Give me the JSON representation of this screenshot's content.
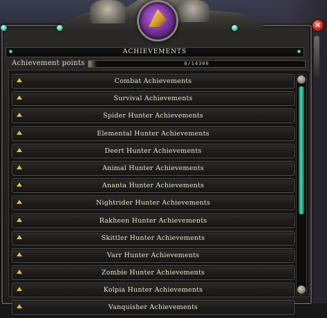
{
  "window": {
    "title": "ACHIEVEMENTS",
    "close_icon": "close-icon",
    "emblem_icon": "achievement-emblem-icon"
  },
  "points": {
    "label": "Achievement points",
    "value_text": "0/14300",
    "earned": 0,
    "total": 14300
  },
  "categories": [
    {
      "label": "Combat Achievements"
    },
    {
      "label": "Survival Achievements"
    },
    {
      "label": "Spider Hunter Achievements"
    },
    {
      "label": "Elemental Hunter Achievements"
    },
    {
      "label": "Deert Hunter Achievements"
    },
    {
      "label": "Animal Hunter Achievements"
    },
    {
      "label": "Ananta Hunter Achievements"
    },
    {
      "label": "Nightrider Hunter Achievements"
    },
    {
      "label": "Rakheen Hunter Achievements"
    },
    {
      "label": "Skittler Hunter Achievements"
    },
    {
      "label": "Varr Hunter Achievements"
    },
    {
      "label": "Zombie Hunter Achievements"
    },
    {
      "label": "Kolpia Hunter Achievements"
    },
    {
      "label": "Vanquisher Achievements"
    }
  ],
  "colors": {
    "accent_teal": "#3fd9b6",
    "arrow_gold": "#e2c04a",
    "text": "#ece4cc"
  }
}
